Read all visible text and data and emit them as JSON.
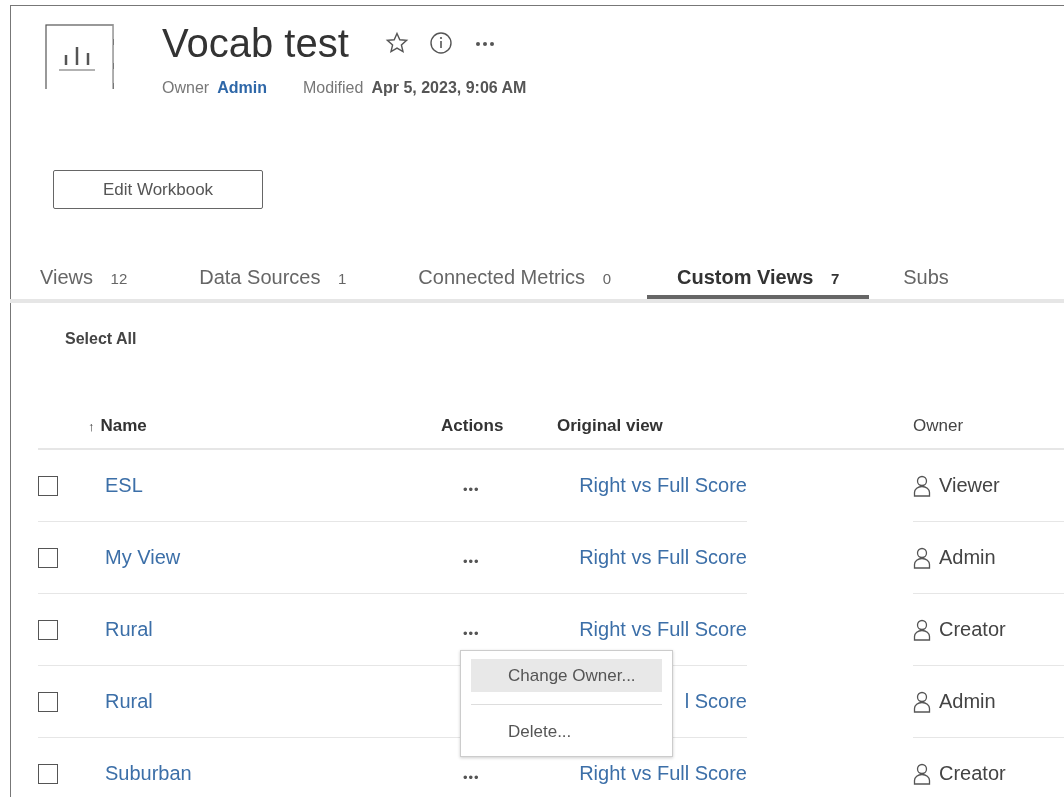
{
  "workbook": {
    "title": "Vocab test",
    "owner_label": "Owner",
    "owner": "Admin",
    "modified_label": "Modified",
    "modified": "Apr 5, 2023, 9:06 AM",
    "edit_button": "Edit Workbook"
  },
  "tabs": [
    {
      "label": "Views",
      "count": "12",
      "selected": false
    },
    {
      "label": "Data Sources",
      "count": "1",
      "selected": false
    },
    {
      "label": "Connected Metrics",
      "count": "0",
      "selected": false
    },
    {
      "label": "Custom Views",
      "count": "7",
      "selected": true
    },
    {
      "label": "Subs",
      "selected": false
    }
  ],
  "select_all": "Select All",
  "table": {
    "columns": [
      {
        "label": "Name",
        "sort_icon": "↑"
      },
      {
        "label": "Actions"
      },
      {
        "label": "Original view"
      },
      {
        "label": "Owner"
      }
    ],
    "rows": [
      {
        "checked": false,
        "name": "ESL",
        "actions": "•••",
        "original_view": "Right vs Full Score",
        "owner": "Viewer"
      },
      {
        "checked": false,
        "name": "My View",
        "actions": "•••",
        "original_view": "Right vs Full Score",
        "owner": "Admin"
      },
      {
        "checked": false,
        "name": "Rural",
        "actions": "•••",
        "original_view": "Right vs Full Score",
        "owner": "Creator"
      },
      {
        "checked": false,
        "name": "Rural",
        "original_view": "l Score",
        "owner": "Admin"
      },
      {
        "checked": false,
        "name": "Suburban",
        "actions": "•••",
        "original_view": "Right vs Full Score",
        "owner": "Creator"
      }
    ]
  },
  "context_menu": {
    "items": [
      {
        "label": "Change Owner...",
        "selected": true
      },
      {
        "label": "Delete...",
        "selected": false
      }
    ]
  }
}
